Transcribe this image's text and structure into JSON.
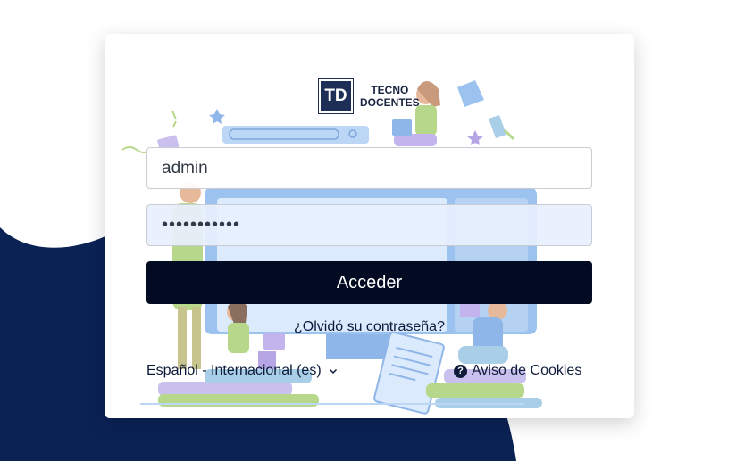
{
  "brand": {
    "logo_mark": "TD",
    "logo_line1": "TECNO",
    "logo_line2": "DOCENTES"
  },
  "login": {
    "username_value": "admin",
    "password_value": "•••••••••••",
    "submit_label": "Acceder",
    "forgot_label": "¿Olvidó su contraseña?"
  },
  "footer": {
    "language_label": "Español - Internacional (es)",
    "cookies_label": "Aviso de Cookies",
    "cookies_icon": "question-circle-icon"
  },
  "colors": {
    "brand_navy": "#0b2255",
    "button_bg": "#020b22",
    "text_dark": "#0d1a3a"
  }
}
